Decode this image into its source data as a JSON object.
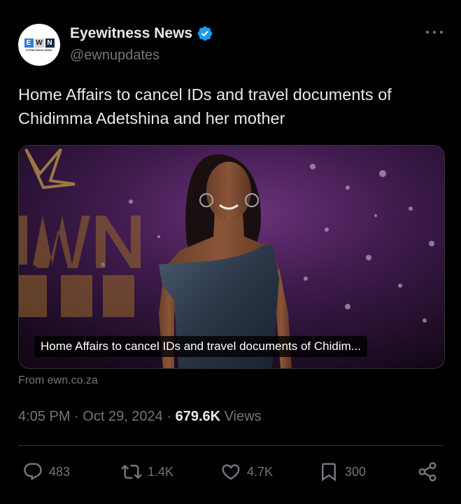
{
  "author": {
    "display_name": "Eyewitness News",
    "handle": "@ewnupdates",
    "avatar_letters": [
      "E",
      "W",
      "N"
    ],
    "avatar_tagline": "EYEWITNESS NEWS",
    "verified": true
  },
  "tweet": {
    "text": "Home Affairs to cancel IDs and travel documents of Chidimma Adetshina and her mother"
  },
  "card": {
    "caption": "Home Affairs to cancel IDs and travel documents of Chidim...",
    "source": "From ewn.co.za",
    "photo_icon": "photo-woman-on-stage"
  },
  "meta": {
    "time": "4:05 PM",
    "separator": "·",
    "date": "Oct 29, 2024",
    "views_count": "679.6K",
    "views_label": "Views"
  },
  "actions": {
    "replies": "483",
    "reposts": "1.4K",
    "likes": "4.7K",
    "bookmarks": "300"
  },
  "icons": {
    "verified": "verified-badge-icon",
    "more": "more-icon",
    "reply": "reply-icon",
    "repost": "repost-icon",
    "like": "like-icon",
    "bookmark": "bookmark-icon",
    "share": "share-icon"
  },
  "colors": {
    "background": "#000000",
    "text_primary": "#e7e9ea",
    "text_secondary": "#71767b",
    "verified_blue": "#1d9bf0",
    "divider": "#2f3336"
  }
}
